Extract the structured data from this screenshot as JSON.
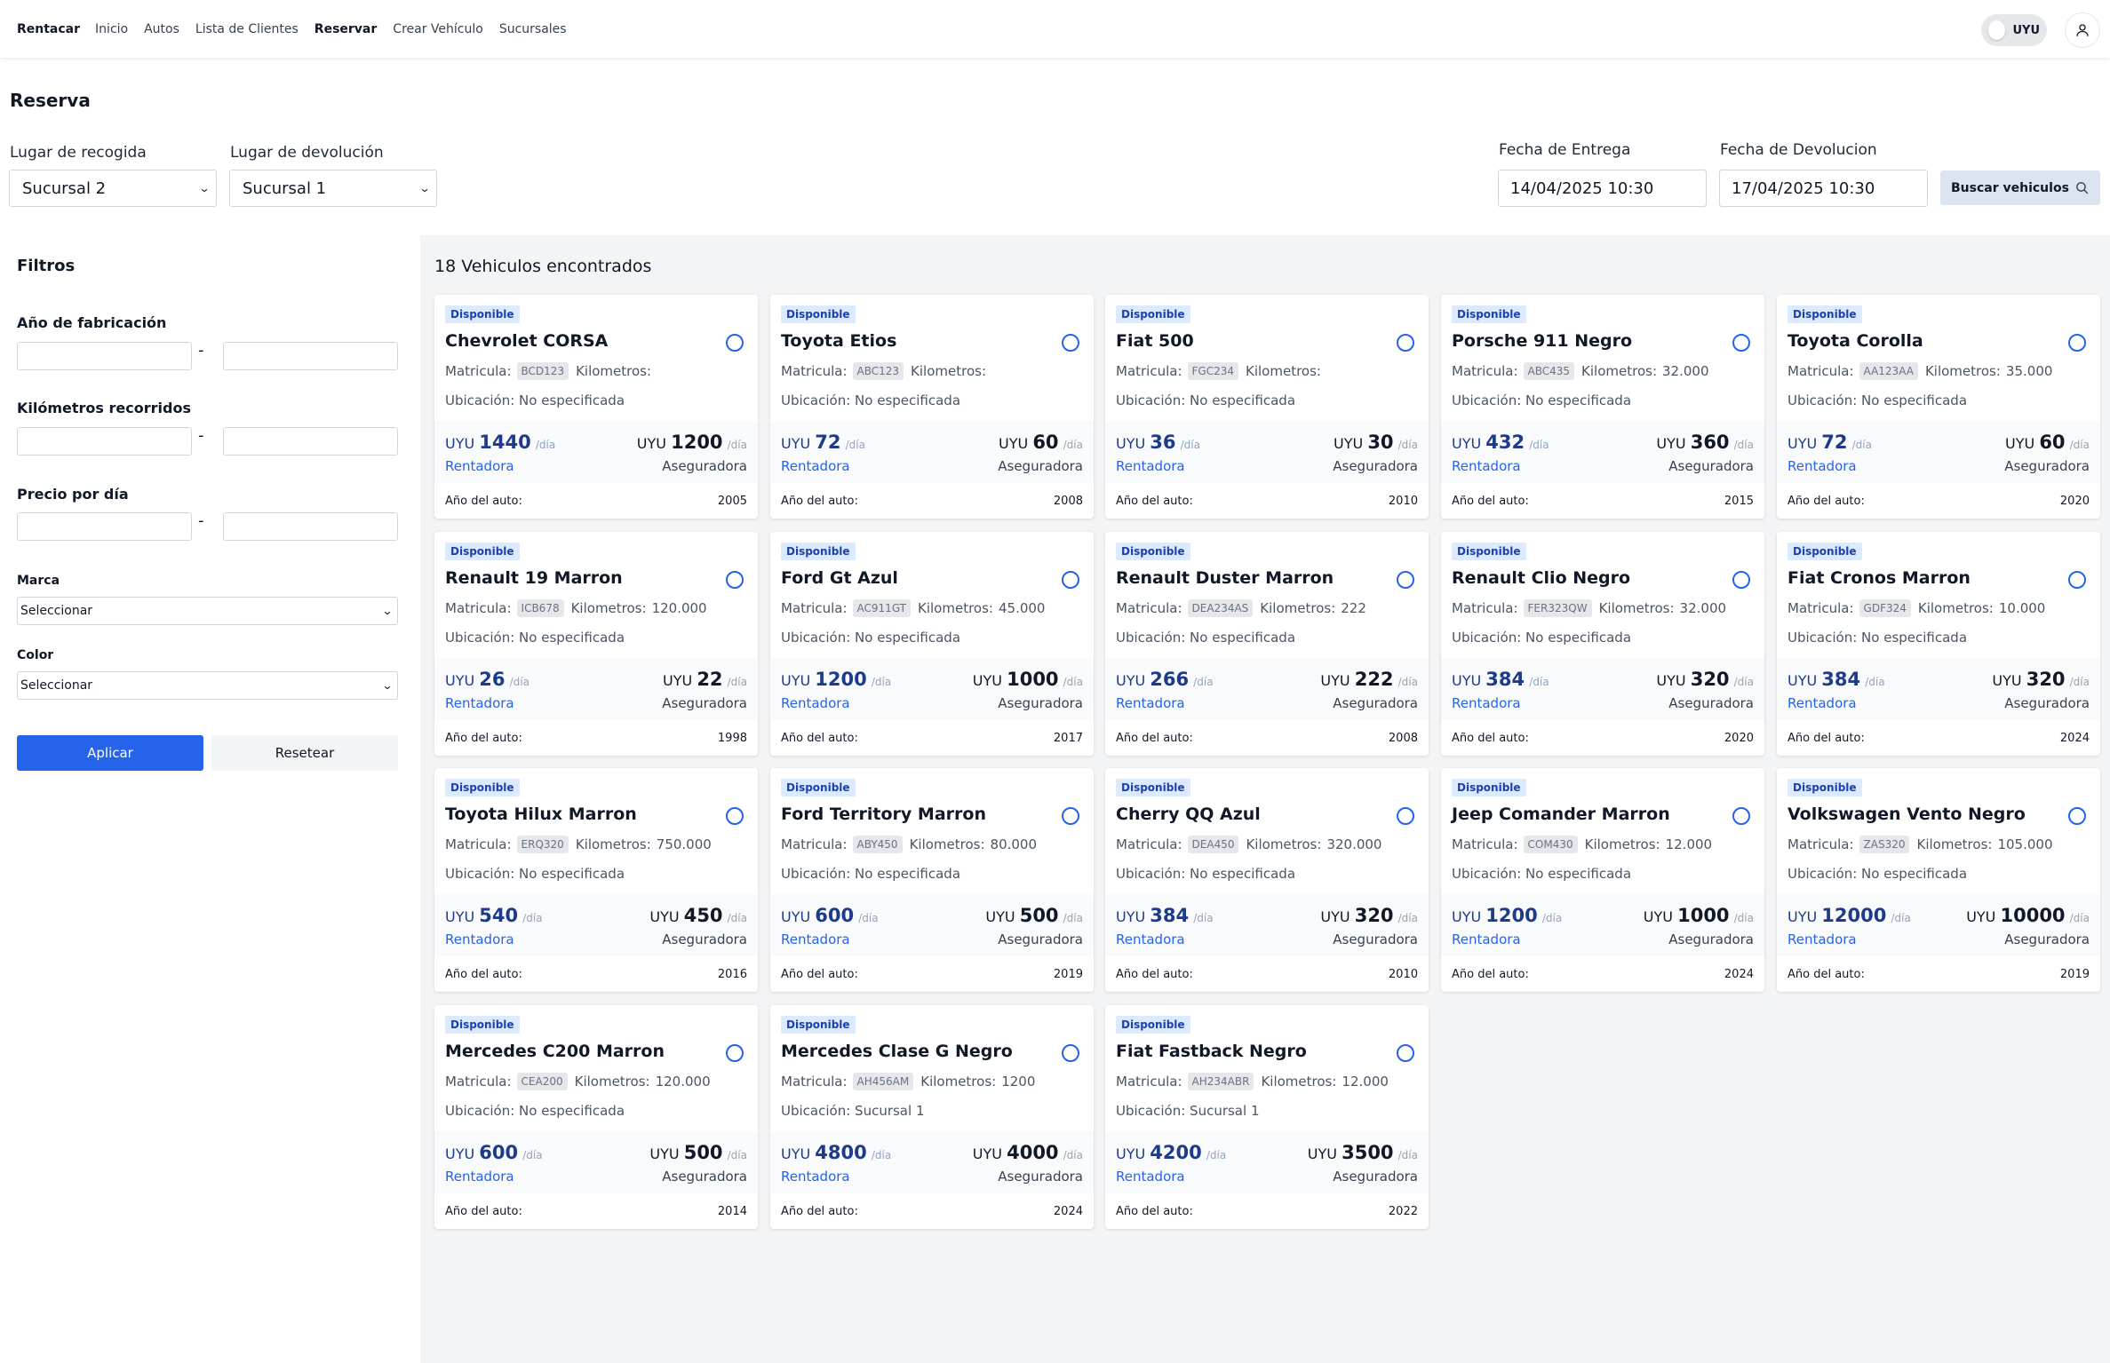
{
  "nav": {
    "brand": "Rentacar",
    "links": [
      {
        "label": "Inicio"
      },
      {
        "label": "Autos"
      },
      {
        "label": "Lista de Clientes"
      },
      {
        "label": "Reservar"
      },
      {
        "label": "Crear Vehículo"
      },
      {
        "label": "Sucursales"
      }
    ],
    "active": "Reservar",
    "currency": "UYU"
  },
  "page": {
    "title": "Reserva",
    "pickup_label": "Lugar de recogida",
    "pickup_value": "Sucursal 2",
    "return_label": "Lugar de devolución",
    "return_value": "Sucursal 1",
    "delivery_date_label": "Fecha de Entrega",
    "delivery_date_value": "14/04/2025 10:30",
    "return_date_label": "Fecha de Devolucion",
    "return_date_value": "17/04/2025 10:30",
    "search_button": "Buscar vehiculos"
  },
  "filters": {
    "title": "Filtros",
    "year_label": "Año de fabricación",
    "km_label": "Kilómetros recorridos",
    "price_label": "Precio por día",
    "range_separator": "-",
    "brand_label": "Marca",
    "brand_value": "Seleccionar",
    "color_label": "Color",
    "color_value": "Seleccionar",
    "apply_button": "Aplicar",
    "reset_button": "Resetear"
  },
  "results": {
    "count_text": "18 Vehiculos encontrados",
    "badge": "Disponible",
    "plate_label": "Matricula:",
    "km_label": "Kilometros:",
    "location_label": "Ubicación:",
    "currency": "UYU",
    "per_day": "/día",
    "rent_label": "Rentadora",
    "insurance_label": "Aseguradora",
    "year_label": "Año del auto:",
    "vehicles": [
      {
        "name": "Chevrolet CORSA",
        "plate": "BCD123",
        "km": "",
        "location": "No especificada",
        "rent": "1440",
        "insurance": "1200",
        "year": "2005"
      },
      {
        "name": "Toyota Etios",
        "plate": "ABC123",
        "km": "",
        "location": "No especificada",
        "rent": "72",
        "insurance": "60",
        "year": "2008"
      },
      {
        "name": "Fiat 500",
        "plate": "FGC234",
        "km": "",
        "location": "No especificada",
        "rent": "36",
        "insurance": "30",
        "year": "2010"
      },
      {
        "name": "Porsche 911 Negro",
        "plate": "ABC435",
        "km": "32.000",
        "location": "No especificada",
        "rent": "432",
        "insurance": "360",
        "year": "2015"
      },
      {
        "name": "Toyota Corolla",
        "plate": "AA123AA",
        "km": "35.000",
        "location": "No especificada",
        "rent": "72",
        "insurance": "60",
        "year": "2020"
      },
      {
        "name": "Renault 19 Marron",
        "plate": "ICB678",
        "km": "120.000",
        "location": "No especificada",
        "rent": "26",
        "insurance": "22",
        "year": "1998"
      },
      {
        "name": "Ford Gt Azul",
        "plate": "AC911GT",
        "km": "45.000",
        "location": "No especificada",
        "rent": "1200",
        "insurance": "1000",
        "year": "2017"
      },
      {
        "name": "Renault Duster Marron",
        "plate": "DEA234AS",
        "km": "222",
        "location": "No especificada",
        "rent": "266",
        "insurance": "222",
        "year": "2008"
      },
      {
        "name": "Renault Clio Negro",
        "plate": "FER323QW",
        "km": "32.000",
        "location": "No especificada",
        "rent": "384",
        "insurance": "320",
        "year": "2020"
      },
      {
        "name": "Fiat Cronos Marron",
        "plate": "GDF324",
        "km": "10.000",
        "location": "No especificada",
        "rent": "384",
        "insurance": "320",
        "year": "2024"
      },
      {
        "name": "Toyota Hilux Marron",
        "plate": "ERQ320",
        "km": "750.000",
        "location": "No especificada",
        "rent": "540",
        "insurance": "450",
        "year": "2016"
      },
      {
        "name": "Ford Territory Marron",
        "plate": "ABY450",
        "km": "80.000",
        "location": "No especificada",
        "rent": "600",
        "insurance": "500",
        "year": "2019"
      },
      {
        "name": "Cherry QQ Azul",
        "plate": "DEA450",
        "km": "320.000",
        "location": "No especificada",
        "rent": "384",
        "insurance": "320",
        "year": "2010"
      },
      {
        "name": "Jeep Comander Marron",
        "plate": "COM430",
        "km": "12.000",
        "location": "No especificada",
        "rent": "1200",
        "insurance": "1000",
        "year": "2024"
      },
      {
        "name": "Volkswagen Vento Negro",
        "plate": "ZAS320",
        "km": "105.000",
        "location": "No especificada",
        "rent": "12000",
        "insurance": "10000",
        "year": "2019"
      },
      {
        "name": "Mercedes C200 Marron",
        "plate": "CEA200",
        "km": "120.000",
        "location": "No especificada",
        "rent": "600",
        "insurance": "500",
        "year": "2014"
      },
      {
        "name": "Mercedes Clase G Negro",
        "plate": "AH456AM",
        "km": "1200",
        "location": "Sucursal 1",
        "rent": "4800",
        "insurance": "4000",
        "year": "2024"
      },
      {
        "name": "Fiat Fastback Negro",
        "plate": "AH234ABR",
        "km": "12.000",
        "location": "Sucursal 1",
        "rent": "4200",
        "insurance": "3500",
        "year": "2022"
      }
    ]
  }
}
